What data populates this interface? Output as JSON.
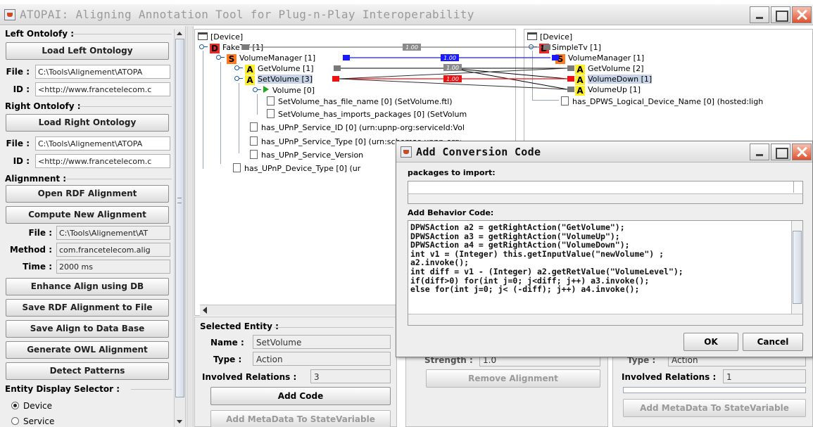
{
  "window": {
    "title": "ATOPAI: Aligning Annotation Tool for Plug-n-Play Interoperability"
  },
  "left": {
    "left_ontology_label": "Left Ontolofy :",
    "load_left": "Load Left Ontology",
    "file_label": "File :",
    "left_file": "C:\\Tools\\Alignement\\ATOPA",
    "id_label": "ID :",
    "left_id": "<http://www.francetelecom.c",
    "right_ontology_label": "Right Ontolofy :",
    "load_right": "Load Right Ontology",
    "right_file": "C:\\Tools\\Alignement\\ATOPA",
    "right_id": "<http://www.francetelecom.c",
    "alignment_label": "Alignmnent :",
    "open_rdf": "Open RDF Alignment",
    "compute": "Compute New Alignment",
    "align_file_label": "File :",
    "align_file": "C:\\Tools\\Alignement\\AT",
    "method_label": "Method :",
    "method": "com.francetelecom.alig",
    "time_label": "Time :",
    "time": "2000 ms",
    "enhance": "Enhance Align using DB",
    "save_rdf": "Save RDF Alignment to File",
    "save_db": "Save Align to Data Base",
    "gen_owl": "Generate OWL Alignment",
    "detect": "Detect Patterns",
    "entity_selector_label": "Entity Display Selector :",
    "radio_device": "Device",
    "radio_service": "Service"
  },
  "left_tree": {
    "root": "[Device]",
    "nodes": [
      {
        "badge": "D",
        "text": "FakeTV [1]"
      },
      {
        "badge": "S",
        "text": "VolumeManager [1]"
      },
      {
        "badge": "A",
        "text": "GetVolume [1]"
      },
      {
        "badge": "A",
        "text": "SetVolume [3]"
      },
      {
        "badge": "",
        "text": "Volume [0]"
      },
      {
        "badge": "",
        "text": "SetVolume_has_file_name [0] (SetVolume.ftl)"
      },
      {
        "badge": "",
        "text": "SetVolume_has_imports_packages [0] (SetVolum"
      },
      {
        "badge": "",
        "text": "has_UPnP_Service_ID [0] (urn:upnp-org:serviceId:Vol"
      },
      {
        "badge": "",
        "text": "has_UPnP_Service_Type [0] (urn:schemas-upnp-org:"
      },
      {
        "badge": "",
        "text": "has_UPnP_Service_Version"
      },
      {
        "badge": "",
        "text": "has_UPnP_Device_Type [0] (ur"
      }
    ]
  },
  "right_tree": {
    "root": "[Device]",
    "nodes": [
      {
        "badge": "D",
        "text": "SimpleTv [1]"
      },
      {
        "badge": "S",
        "text": "VolumeManager [1]"
      },
      {
        "badge": "A",
        "text": "GetVolume [2]"
      },
      {
        "badge": "A",
        "text": "VolumeDown [1]"
      },
      {
        "badge": "A",
        "text": "VolumeUp [1]"
      },
      {
        "badge": "",
        "text": "has_DPWS_Logical_Device_Name [0] (hosted:ligh"
      }
    ]
  },
  "links": {
    "device": "1.00",
    "service": "1.00",
    "getvolume": "1.00",
    "setvolume": "1.00"
  },
  "selected_entity": {
    "title": "Selected Entity :",
    "name_label": "Name :",
    "name": "SetVolume",
    "type_label": "Type :",
    "type": "Action",
    "relations_label": "Involved Relations :",
    "relations": "3",
    "add_code": "Add Code",
    "add_meta": "Add MetaData To StateVariable"
  },
  "middle_panel": {
    "strength_label": "Strength :",
    "strength": "1.0",
    "remove": "Remove Alignment"
  },
  "right_entity": {
    "type_label": "Type :",
    "type": "Action",
    "relations_label": "Involved Relations :",
    "relations": "1",
    "add_meta": "Add MetaData To StateVariable"
  },
  "dialog": {
    "title": "Add Conversion Code",
    "packages_label": "packages to import:",
    "behavior_label": "Add Behavior Code:",
    "code": "DPWSAction a2 = getRightAction(\"GetVolume\");\nDPWSAction a3 = getRightAction(\"VolumeUp\");\nDPWSAction a4 = getRightAction(\"VolumeDown\");\nint v1 = (Integer) this.getInputValue(\"newVolume\") ;\na2.invoke();\nint diff = v1 - (Integer) a2.getRetValue(\"VolumeLevel\");\nif(diff>0) for(int j=0; j<diff; j++) a3.invoke();\nelse for(int j=0; j< (-diff); j++) a4.invoke();",
    "ok": "OK",
    "cancel": "Cancel"
  },
  "colors": {
    "device": "#e82a2a",
    "service": "#ff7a20",
    "action": "#ffee22",
    "link_blue": "#1a1aff",
    "link_red": "#ee1111",
    "link_gray": "#7a7a7a"
  }
}
